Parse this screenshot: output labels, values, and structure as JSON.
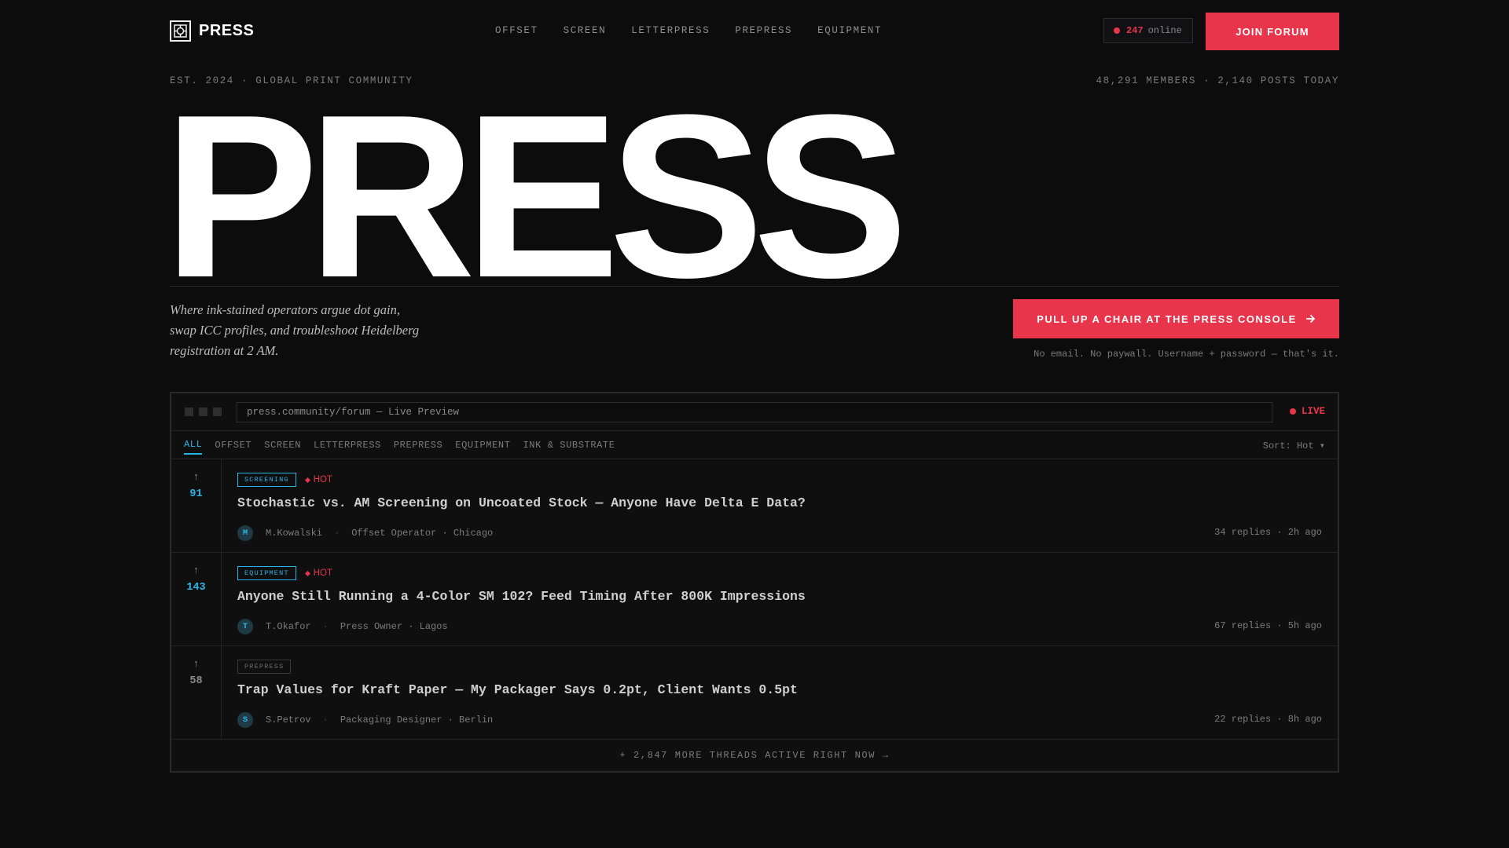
{
  "brand": {
    "name": "PRESS"
  },
  "nav": [
    "OFFSET",
    "SCREEN",
    "LETTERPRESS",
    "PREPRESS",
    "EQUIPMENT"
  ],
  "online": {
    "count": "247",
    "label": "online"
  },
  "join_label": "JOIN FORUM",
  "meta": {
    "left": "EST. 2024 · GLOBAL PRINT COMMUNITY",
    "right": "48,291 MEMBERS · 2,140 POSTS TODAY"
  },
  "hero": {
    "word": "PRESS"
  },
  "tagline": "Where ink-stained operators argue dot gain, swap ICC profiles, and troubleshoot Heidelberg registration at 2 AM.",
  "cta": {
    "label": "PULL UP A CHAIR AT THE PRESS CONSOLE",
    "note": "No email. No paywall. Username + password — that's it."
  },
  "preview": {
    "url": "press.community/forum — Live Preview",
    "live_label": "LIVE",
    "tabs": [
      "ALL",
      "OFFSET",
      "SCREEN",
      "LETTERPRESS",
      "PREPRESS",
      "EQUIPMENT",
      "INK & SUBSTRATE"
    ],
    "sort_label": "Sort: Hot ▾",
    "threads": [
      {
        "votes": "91",
        "tag": "SCREENING",
        "hot": "HOT",
        "title": "Stochastic vs. AM Screening on Uncoated Stock — Anyone Have Delta E Data?",
        "avatar": "M",
        "author": "M.Kowalski",
        "role": "Offset Operator · Chicago",
        "stats": "34 replies · 2h ago"
      },
      {
        "votes": "143",
        "tag": "EQUIPMENT",
        "hot": "HOT",
        "title": "Anyone Still Running a 4-Color SM 102? Feed Timing After 800K Impressions",
        "avatar": "T",
        "author": "T.Okafor",
        "role": "Press Owner · Lagos",
        "stats": "67 replies · 5h ago"
      },
      {
        "votes": "58",
        "tag": "PREPRESS",
        "hot": "",
        "title": "Trap Values for Kraft Paper — My Packager Says 0.2pt, Client Wants 0.5pt",
        "avatar": "S",
        "author": "S.Petrov",
        "role": "Packaging Designer · Berlin",
        "stats": "22 replies · 8h ago"
      }
    ],
    "more_label": "+ 2,847 MORE THREADS ACTIVE RIGHT NOW →"
  },
  "colors": {
    "accent": "#e8354b",
    "link": "#29b6e6",
    "background": "#0c0c0d"
  }
}
